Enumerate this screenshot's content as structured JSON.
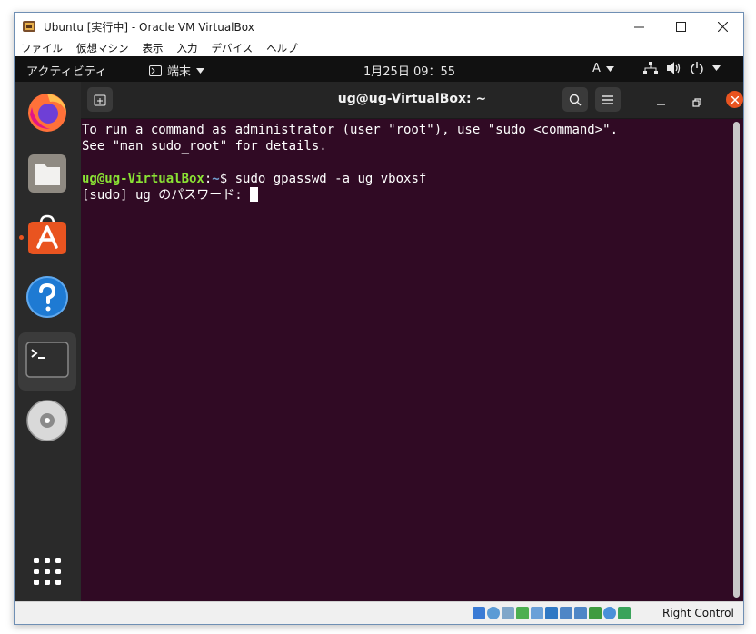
{
  "window": {
    "title": "Ubuntu [実行中] - Oracle VM VirtualBox"
  },
  "menu": [
    "ファイル",
    "仮想マシン",
    "表示",
    "入力",
    "デバイス",
    "ヘルプ"
  ],
  "topbar": {
    "activities": "アクティビティ",
    "app_menu": "端末",
    "clock": "1月25日  09：55",
    "input_method": "A"
  },
  "dock": {
    "items": [
      "firefox",
      "files",
      "ubuntu-software",
      "help",
      "terminal",
      "dvd"
    ]
  },
  "terminal": {
    "title": "ug@ug-VirtualBox: ~",
    "lines": [
      "To run a command as administrator (user \"root\"), use \"sudo <command>\".",
      "See \"man sudo_root\" for details."
    ],
    "prompt_user": "ug@ug-VirtualBox",
    "prompt_sep": ":",
    "prompt_path": "~",
    "prompt_end": "$ ",
    "command": "sudo gpasswd -a ug vboxsf",
    "sudo_prompt": "[sudo] ug のパスワード: "
  },
  "statusbar": {
    "host_key": "Right Control"
  },
  "colors": {
    "terminal_bg": "#300a24",
    "ubuntu_orange": "#e95420",
    "prompt_green": "#8ae234",
    "prompt_blue": "#729fcf"
  }
}
